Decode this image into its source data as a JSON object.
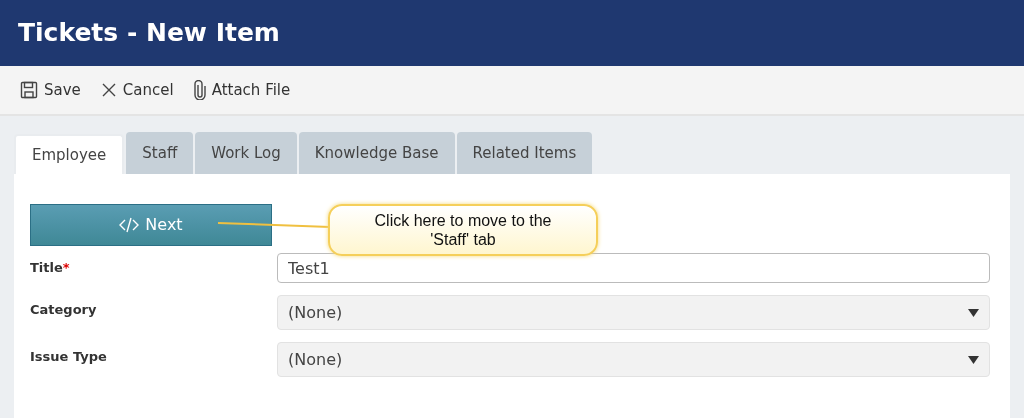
{
  "header": {
    "title": "Tickets - New Item"
  },
  "toolbar": [
    {
      "kind": "save",
      "label": "Save"
    },
    {
      "kind": "cancel",
      "label": "Cancel"
    },
    {
      "kind": "attach",
      "label": "Attach File"
    }
  ],
  "tabs": [
    {
      "label": "Employee",
      "selected": true
    },
    {
      "label": "Staff",
      "selected": false
    },
    {
      "label": "Work Log",
      "selected": false
    },
    {
      "label": "Knowledge Base",
      "selected": false
    },
    {
      "label": "Related Items",
      "selected": false
    }
  ],
  "next_button": {
    "label": "Next"
  },
  "callout": {
    "text": "Click here to move to the 'Staff' tab"
  },
  "fields": [
    {
      "kind": "text",
      "label": "Title",
      "required_mark": "*",
      "value": "Test1"
    },
    {
      "kind": "select",
      "label": "Category",
      "value": "(None)"
    },
    {
      "kind": "select",
      "label": "Issue Type",
      "value": "(None)"
    }
  ]
}
